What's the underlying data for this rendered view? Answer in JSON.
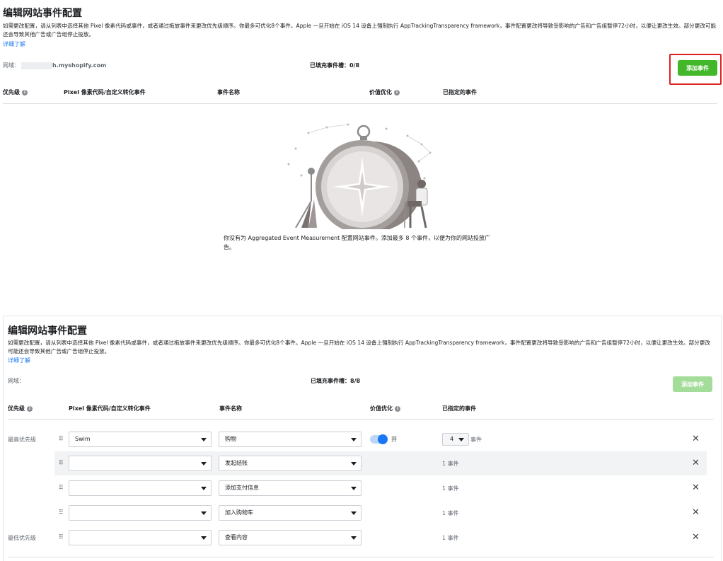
{
  "top": {
    "title": "编辑网站事件配置",
    "desc": "如需更改配置，请从列表中选择其他 Pixel 像素代码或事件，或者通过拖放事件来更改优先级顺序。你最多可优化8个事件。Apple 一旦开始在 iOS 14 设备上强制执行 AppTrackingTransparency framework，事件配置更改将导致受影响的广告和广告组暂停72小时，以便让更改生效。部分更改可能还会导致其他广告或广告组停止投放。",
    "learn_more": "详细了解",
    "domain_label": "网域：",
    "domain_value": "h.myshopify.com",
    "slots": "已填充事件槽：0/8",
    "add_button": "添加事件",
    "columns": {
      "priority": "优先级",
      "pixel": "Pixel 像素代码/自定义转化事件",
      "event_name": "事件名称",
      "value_opt": "价值优化",
      "assigned": "已指定的事件"
    },
    "empty_message": "你没有为 Aggregated Event Measurement 配置网站事件。添加最多 8 个事件，以便为你的网站投放广告。"
  },
  "bottom": {
    "title": "编辑网站事件配置",
    "desc": "如需更改配置，请从列表中选择其他 Pixel 像素代码或事件，或者通过拖放事件来更改优先级顺序。你最多可优化8个事件。Apple 一旦开始在 iOS 14 设备上强制执行 AppTrackingTransparency framework，事件配置更改将导致受影响的广告和广告组暂停72小时，以便让更改生效。部分更改可能还会导致其他广告或广告组停止投放。",
    "learn_more": "详细了解",
    "domain_label": "网域：",
    "slots": "已填充事件槽：8/8",
    "add_button": "添加事件",
    "columns": {
      "priority": "优先级",
      "pixel": "Pixel 像素代码/自定义转化事件",
      "event_name": "事件名称",
      "value_opt": "价值优化",
      "assigned": "已指定的事件"
    },
    "rows": [
      {
        "priority": "最高优先级",
        "pixel": "Swim",
        "event": "购物",
        "toggle": "开",
        "count": "4",
        "events": "事件"
      },
      {
        "priority": "",
        "pixel": "",
        "event": "发起结账",
        "events": "1 事件"
      },
      {
        "priority": "",
        "pixel": "",
        "event": "添加支付信息",
        "events": "1 事件"
      },
      {
        "priority": "",
        "pixel": "",
        "event": "加入购物车",
        "events": "1 事件"
      },
      {
        "priority": "最低优先级",
        "pixel": "",
        "event": "查看内容",
        "events": "1 事件"
      }
    ]
  },
  "colors": {
    "accent": "#1877f2",
    "add_button": "#42b72a",
    "highlight": "#e02020"
  }
}
